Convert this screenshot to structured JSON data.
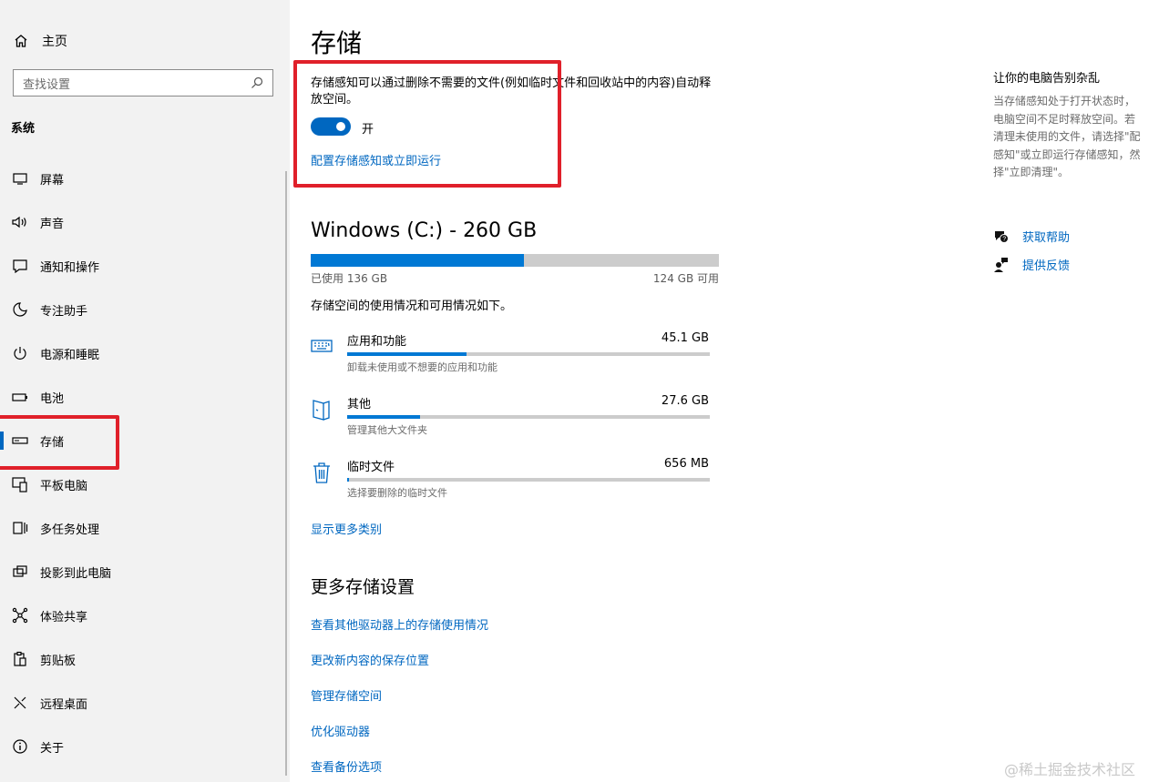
{
  "sidebar": {
    "home_label": "主页",
    "search_placeholder": "查找设置",
    "section_label": "系统",
    "items": [
      {
        "label": "屏幕",
        "icon": "display-icon"
      },
      {
        "label": "声音",
        "icon": "speaker-icon"
      },
      {
        "label": "通知和操作",
        "icon": "notification-icon"
      },
      {
        "label": "专注助手",
        "icon": "moon-icon"
      },
      {
        "label": "电源和睡眠",
        "icon": "power-icon"
      },
      {
        "label": "电池",
        "icon": "battery-icon"
      },
      {
        "label": "存储",
        "icon": "storage-icon",
        "selected": true
      },
      {
        "label": "平板电脑",
        "icon": "tablet-icon"
      },
      {
        "label": "多任务处理",
        "icon": "multitask-icon"
      },
      {
        "label": "投影到此电脑",
        "icon": "project-icon"
      },
      {
        "label": "体验共享",
        "icon": "share-icon"
      },
      {
        "label": "剪贴板",
        "icon": "clipboard-icon"
      },
      {
        "label": "远程桌面",
        "icon": "remote-icon"
      },
      {
        "label": "关于",
        "icon": "info-icon"
      }
    ]
  },
  "main": {
    "title": "存储",
    "storage_sense": {
      "description": "存储感知可以通过删除不需要的文件(例如临时文件和回收站中的内容)自动释放空间。",
      "toggle_on": true,
      "toggle_label": "开",
      "configure_link": "配置存储感知或立即运行"
    },
    "drive": {
      "title": "Windows (C:) - 260 GB",
      "used_fraction": 0.523,
      "used_label": "已使用 136 GB",
      "available_label": "124 GB 可用",
      "usage_desc": "存储空间的使用情况和可用情况如下。"
    },
    "categories": [
      {
        "name": "应用和功能",
        "size": "45.1 GB",
        "desc": "卸载未使用或不想要的应用和功能",
        "fraction": 0.33,
        "icon": "apps-keyboard-icon"
      },
      {
        "name": "其他",
        "size": "27.6 GB",
        "desc": "管理其他大文件夹",
        "fraction": 0.2,
        "icon": "other-files-icon"
      },
      {
        "name": "临时文件",
        "size": "656 MB",
        "desc": "选择要删除的临时文件",
        "fraction": 0.005,
        "icon": "trash-icon"
      }
    ],
    "show_more": "显示更多类别",
    "more_settings": {
      "title": "更多存储设置",
      "links": [
        "查看其他驱动器上的存储使用情况",
        "更改新内容的保存位置",
        "管理存储空间",
        "优化驱动器",
        "查看备份选项"
      ]
    }
  },
  "right_panel": {
    "title": "让你的电脑告别杂乱",
    "description": "当存储感知处于打开状态时，\n电脑空间不足时释放空间。若\n清理未使用的文件，请选择\"配\n感知\"或立即运行存储感知，然\n择\"立即清理\"。",
    "help_link": "获取帮助",
    "feedback_link": "提供反馈"
  },
  "watermark": "@稀土掘金技术社区",
  "colors": {
    "accent": "#0067c0",
    "highlight": "#e0202a",
    "bar_fill": "#0078d4",
    "bar_track": "#cccccc"
  }
}
